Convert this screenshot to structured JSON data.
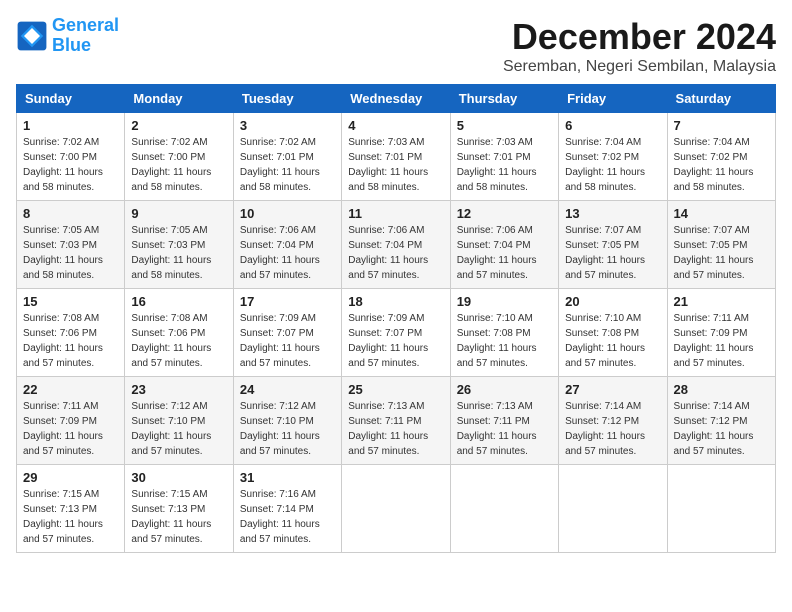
{
  "header": {
    "logo_line1": "General",
    "logo_line2": "Blue",
    "month_title": "December 2024",
    "subtitle": "Seremban, Negeri Sembilan, Malaysia"
  },
  "weekdays": [
    "Sunday",
    "Monday",
    "Tuesday",
    "Wednesday",
    "Thursday",
    "Friday",
    "Saturday"
  ],
  "weeks": [
    [
      {
        "day": "1",
        "sunrise": "7:02 AM",
        "sunset": "7:00 PM",
        "daylight": "11 hours and 58 minutes."
      },
      {
        "day": "2",
        "sunrise": "7:02 AM",
        "sunset": "7:00 PM",
        "daylight": "11 hours and 58 minutes."
      },
      {
        "day": "3",
        "sunrise": "7:02 AM",
        "sunset": "7:01 PM",
        "daylight": "11 hours and 58 minutes."
      },
      {
        "day": "4",
        "sunrise": "7:03 AM",
        "sunset": "7:01 PM",
        "daylight": "11 hours and 58 minutes."
      },
      {
        "day": "5",
        "sunrise": "7:03 AM",
        "sunset": "7:01 PM",
        "daylight": "11 hours and 58 minutes."
      },
      {
        "day": "6",
        "sunrise": "7:04 AM",
        "sunset": "7:02 PM",
        "daylight": "11 hours and 58 minutes."
      },
      {
        "day": "7",
        "sunrise": "7:04 AM",
        "sunset": "7:02 PM",
        "daylight": "11 hours and 58 minutes."
      }
    ],
    [
      {
        "day": "8",
        "sunrise": "7:05 AM",
        "sunset": "7:03 PM",
        "daylight": "11 hours and 58 minutes."
      },
      {
        "day": "9",
        "sunrise": "7:05 AM",
        "sunset": "7:03 PM",
        "daylight": "11 hours and 58 minutes."
      },
      {
        "day": "10",
        "sunrise": "7:06 AM",
        "sunset": "7:04 PM",
        "daylight": "11 hours and 57 minutes."
      },
      {
        "day": "11",
        "sunrise": "7:06 AM",
        "sunset": "7:04 PM",
        "daylight": "11 hours and 57 minutes."
      },
      {
        "day": "12",
        "sunrise": "7:06 AM",
        "sunset": "7:04 PM",
        "daylight": "11 hours and 57 minutes."
      },
      {
        "day": "13",
        "sunrise": "7:07 AM",
        "sunset": "7:05 PM",
        "daylight": "11 hours and 57 minutes."
      },
      {
        "day": "14",
        "sunrise": "7:07 AM",
        "sunset": "7:05 PM",
        "daylight": "11 hours and 57 minutes."
      }
    ],
    [
      {
        "day": "15",
        "sunrise": "7:08 AM",
        "sunset": "7:06 PM",
        "daylight": "11 hours and 57 minutes."
      },
      {
        "day": "16",
        "sunrise": "7:08 AM",
        "sunset": "7:06 PM",
        "daylight": "11 hours and 57 minutes."
      },
      {
        "day": "17",
        "sunrise": "7:09 AM",
        "sunset": "7:07 PM",
        "daylight": "11 hours and 57 minutes."
      },
      {
        "day": "18",
        "sunrise": "7:09 AM",
        "sunset": "7:07 PM",
        "daylight": "11 hours and 57 minutes."
      },
      {
        "day": "19",
        "sunrise": "7:10 AM",
        "sunset": "7:08 PM",
        "daylight": "11 hours and 57 minutes."
      },
      {
        "day": "20",
        "sunrise": "7:10 AM",
        "sunset": "7:08 PM",
        "daylight": "11 hours and 57 minutes."
      },
      {
        "day": "21",
        "sunrise": "7:11 AM",
        "sunset": "7:09 PM",
        "daylight": "11 hours and 57 minutes."
      }
    ],
    [
      {
        "day": "22",
        "sunrise": "7:11 AM",
        "sunset": "7:09 PM",
        "daylight": "11 hours and 57 minutes."
      },
      {
        "day": "23",
        "sunrise": "7:12 AM",
        "sunset": "7:10 PM",
        "daylight": "11 hours and 57 minutes."
      },
      {
        "day": "24",
        "sunrise": "7:12 AM",
        "sunset": "7:10 PM",
        "daylight": "11 hours and 57 minutes."
      },
      {
        "day": "25",
        "sunrise": "7:13 AM",
        "sunset": "7:11 PM",
        "daylight": "11 hours and 57 minutes."
      },
      {
        "day": "26",
        "sunrise": "7:13 AM",
        "sunset": "7:11 PM",
        "daylight": "11 hours and 57 minutes."
      },
      {
        "day": "27",
        "sunrise": "7:14 AM",
        "sunset": "7:12 PM",
        "daylight": "11 hours and 57 minutes."
      },
      {
        "day": "28",
        "sunrise": "7:14 AM",
        "sunset": "7:12 PM",
        "daylight": "11 hours and 57 minutes."
      }
    ],
    [
      {
        "day": "29",
        "sunrise": "7:15 AM",
        "sunset": "7:13 PM",
        "daylight": "11 hours and 57 minutes."
      },
      {
        "day": "30",
        "sunrise": "7:15 AM",
        "sunset": "7:13 PM",
        "daylight": "11 hours and 57 minutes."
      },
      {
        "day": "31",
        "sunrise": "7:16 AM",
        "sunset": "7:14 PM",
        "daylight": "11 hours and 57 minutes."
      },
      null,
      null,
      null,
      null
    ]
  ],
  "labels": {
    "sunrise": "Sunrise: ",
    "sunset": "Sunset: ",
    "daylight": "Daylight: "
  }
}
